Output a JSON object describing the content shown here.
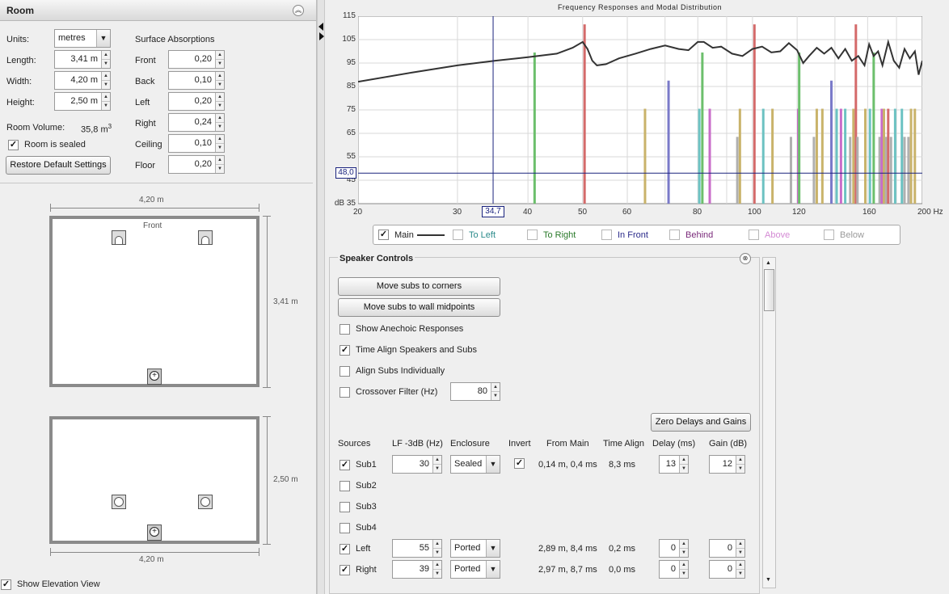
{
  "room_panel": {
    "title": "Room",
    "units_label": "Units:",
    "units_value": "metres",
    "length_label": "Length:",
    "length_value": "3,41 m",
    "width_label": "Width:",
    "width_value": "4,20 m",
    "height_label": "Height:",
    "height_value": "2,50 m",
    "volume_label": "Room Volume:",
    "volume_value": "35,8 m",
    "volume_exp": "3",
    "sealed_label": "Room is sealed",
    "restore_label": "Restore Default Settings",
    "surface_title": "Surface Absorptions",
    "surfaces": [
      {
        "label": "Front",
        "value": "0,20"
      },
      {
        "label": "Back",
        "value": "0,10"
      },
      {
        "label": "Left",
        "value": "0,20"
      },
      {
        "label": "Right",
        "value": "0,24"
      },
      {
        "label": "Ceiling",
        "value": "0,10"
      },
      {
        "label": "Floor",
        "value": "0,20"
      }
    ]
  },
  "plan_view": {
    "width_dim": "4,20 m",
    "depth_dim": "3,41 m",
    "front_label": "Front"
  },
  "elevation_view": {
    "height_dim": "2,50 m",
    "width_dim": "4,20 m"
  },
  "show_elevation_label": "Show Elevation View",
  "chart": {
    "title": "Frequency Responses and Modal Distribution",
    "cursor_x_readout": "34,7",
    "cursor_y_readout": "48,0",
    "y_unit": "dB",
    "x_unit": "Hz"
  },
  "chart_data": {
    "type": "line",
    "title": "Frequency Responses and Modal Distribution",
    "x_scale": "log",
    "xlim": [
      20,
      200
    ],
    "ylim": [
      35,
      115
    ],
    "x_ticks": [
      "20",
      "30",
      "40",
      "50",
      "60",
      "80",
      "100",
      "120",
      "160",
      "200 Hz"
    ],
    "y_ticks": [
      "dB 35",
      "45",
      "55",
      "65",
      "75",
      "85",
      "95",
      "105",
      "115"
    ],
    "grid": true,
    "cursor": {
      "x": 34.7,
      "y": 48.0
    },
    "series": [
      {
        "name": "Main",
        "color": "#333333",
        "x": [
          20,
          25,
          30,
          35,
          40,
          45,
          48,
          50,
          51,
          52,
          53,
          55,
          58,
          62,
          66,
          70,
          74,
          77,
          80,
          82,
          85,
          88,
          92,
          96,
          100,
          104,
          108,
          112,
          116,
          120,
          123,
          126,
          130,
          134,
          138,
          142,
          146,
          150,
          154,
          158,
          161,
          164,
          167,
          170,
          174,
          178,
          182,
          186,
          190,
          194,
          197,
          200
        ],
        "y": [
          87,
          91,
          94,
          96,
          97.5,
          99,
          101.5,
          104,
          101,
          96,
          94,
          94.5,
          97,
          99,
          101,
          102.5,
          101,
          100.5,
          104,
          104,
          101.5,
          102,
          99,
          98,
          101,
          102,
          99.5,
          100,
          103.5,
          100.5,
          95,
          98,
          101.5,
          99,
          101.5,
          97,
          101,
          96,
          98,
          94,
          103,
          98,
          100,
          94,
          104,
          96,
          93,
          101,
          97,
          100,
          90,
          96
        ]
      }
    ],
    "modes": [
      {
        "f": 41.1,
        "top": 99.5,
        "color": "#6cbf6c"
      },
      {
        "f": 50.4,
        "top": 111.5,
        "color": "#d46a6a"
      },
      {
        "f": 64.5,
        "top": 75.5,
        "color": "#c9b36a"
      },
      {
        "f": 71.0,
        "top": 87.5,
        "color": "#7a7ac9"
      },
      {
        "f": 80.5,
        "top": 75.5,
        "color": "#6cc2c2"
      },
      {
        "f": 81.5,
        "top": 99.5,
        "color": "#6cbf6c"
      },
      {
        "f": 84.0,
        "top": 75.5,
        "color": "#c96cc9"
      },
      {
        "f": 94.0,
        "top": 63.5,
        "color": "#b0b0b0"
      },
      {
        "f": 95.0,
        "top": 75.5,
        "color": "#c9b36a"
      },
      {
        "f": 100.8,
        "top": 111.5,
        "color": "#d46a6a"
      },
      {
        "f": 104.5,
        "top": 75.5,
        "color": "#6cc2c2"
      },
      {
        "f": 108.5,
        "top": 75.5,
        "color": "#c9b36a"
      },
      {
        "f": 117.0,
        "top": 63.5,
        "color": "#b0b0b0"
      },
      {
        "f": 120.5,
        "top": 75.5,
        "color": "#c96cc9"
      },
      {
        "f": 121.0,
        "top": 99.5,
        "color": "#6cbf6c"
      },
      {
        "f": 128.5,
        "top": 63.5,
        "color": "#b0b0b0"
      },
      {
        "f": 130.0,
        "top": 75.5,
        "color": "#c9b36a"
      },
      {
        "f": 133.0,
        "top": 75.5,
        "color": "#c9b36a"
      },
      {
        "f": 138.0,
        "top": 87.5,
        "color": "#7a7ac9"
      },
      {
        "f": 141.0,
        "top": 75.5,
        "color": "#6cc2c2"
      },
      {
        "f": 143.5,
        "top": 75.5,
        "color": "#c96cc9"
      },
      {
        "f": 146.0,
        "top": 75.5,
        "color": "#6cc2c2"
      },
      {
        "f": 149.0,
        "top": 63.5,
        "color": "#b0b0b0"
      },
      {
        "f": 151.0,
        "top": 75.5,
        "color": "#c9b36a"
      },
      {
        "f": 152.5,
        "top": 111.5,
        "color": "#d46a6a"
      },
      {
        "f": 153.5,
        "top": 63.5,
        "color": "#b0b0b0"
      },
      {
        "f": 158.5,
        "top": 75.5,
        "color": "#c9b36a"
      },
      {
        "f": 161.5,
        "top": 75.5,
        "color": "#6cc2c2"
      },
      {
        "f": 164.0,
        "top": 99.5,
        "color": "#6cbf6c"
      },
      {
        "f": 168.0,
        "top": 63.5,
        "color": "#b0b0b0"
      },
      {
        "f": 169.5,
        "top": 75.5,
        "color": "#c96cc9"
      },
      {
        "f": 171.0,
        "top": 75.5,
        "color": "#c9b36a"
      },
      {
        "f": 172.5,
        "top": 63.5,
        "color": "#b0b0b0"
      },
      {
        "f": 174.0,
        "top": 75.5,
        "color": "#d46a6a"
      },
      {
        "f": 176.0,
        "top": 63.5,
        "color": "#b0b0b0"
      },
      {
        "f": 179.0,
        "top": 75.5,
        "color": "#6cc2c2"
      },
      {
        "f": 184.0,
        "top": 75.5,
        "color": "#6cc2c2"
      },
      {
        "f": 186.0,
        "top": 63.5,
        "color": "#b0b0b0"
      },
      {
        "f": 189.0,
        "top": 63.5,
        "color": "#b0b0b0"
      },
      {
        "f": 191.0,
        "top": 75.5,
        "color": "#c9b36a"
      },
      {
        "f": 194.0,
        "top": 75.5,
        "color": "#c9b36a"
      }
    ]
  },
  "legend": [
    {
      "label": "Main",
      "checked": true,
      "color": "#222222"
    },
    {
      "label": "To Left",
      "checked": false,
      "color": "#2a8a8a"
    },
    {
      "label": "To Right",
      "checked": false,
      "color": "#2a7a2a"
    },
    {
      "label": "In Front",
      "checked": false,
      "color": "#2a2a8a"
    },
    {
      "label": "Behind",
      "checked": false,
      "color": "#7a2a7a"
    },
    {
      "label": "Above",
      "checked": false,
      "color": "#d48ad4"
    },
    {
      "label": "Below",
      "checked": false,
      "color": "#9a9a9a"
    }
  ],
  "speaker_controls": {
    "title": "Speaker Controls",
    "move_corners_label": "Move subs to corners",
    "move_mid_label": "Move subs to wall midpoints",
    "anechoic_label": "Show Anechoic Responses",
    "time_align_label": "Time Align Speakers and Subs",
    "align_subs_label": "Align Subs Individually",
    "crossover_label": "Crossover Filter (Hz)",
    "crossover_value": "80",
    "zero_label": "Zero Delays and Gains",
    "headers": {
      "sources": "Sources",
      "lf": "LF -3dB (Hz)",
      "enclosure": "Enclosure",
      "invert": "Invert",
      "from_main": "From Main",
      "time_align": "Time Align",
      "delay": "Delay (ms)",
      "gain": "Gain (dB)"
    },
    "rows": [
      {
        "name": "Sub1",
        "checked": true,
        "lf": "30",
        "enclosure": "Sealed",
        "invert": true,
        "from_main": "0,14 m, 0,4 ms",
        "time_align": "8,3 ms",
        "delay": "13",
        "gain": "12"
      },
      {
        "name": "Sub2",
        "checked": false
      },
      {
        "name": "Sub3",
        "checked": false
      },
      {
        "name": "Sub4",
        "checked": false
      },
      {
        "name": "Left",
        "checked": true,
        "lf": "55",
        "enclosure": "Ported",
        "from_main": "2,89 m, 8,4 ms",
        "time_align": "0,2 ms",
        "delay": "0",
        "gain": "0"
      },
      {
        "name": "Right",
        "checked": true,
        "lf": "39",
        "enclosure": "Ported",
        "from_main": "2,97 m, 8,7 ms",
        "time_align": "0,0 ms",
        "delay": "0",
        "gain": "0"
      }
    ]
  }
}
